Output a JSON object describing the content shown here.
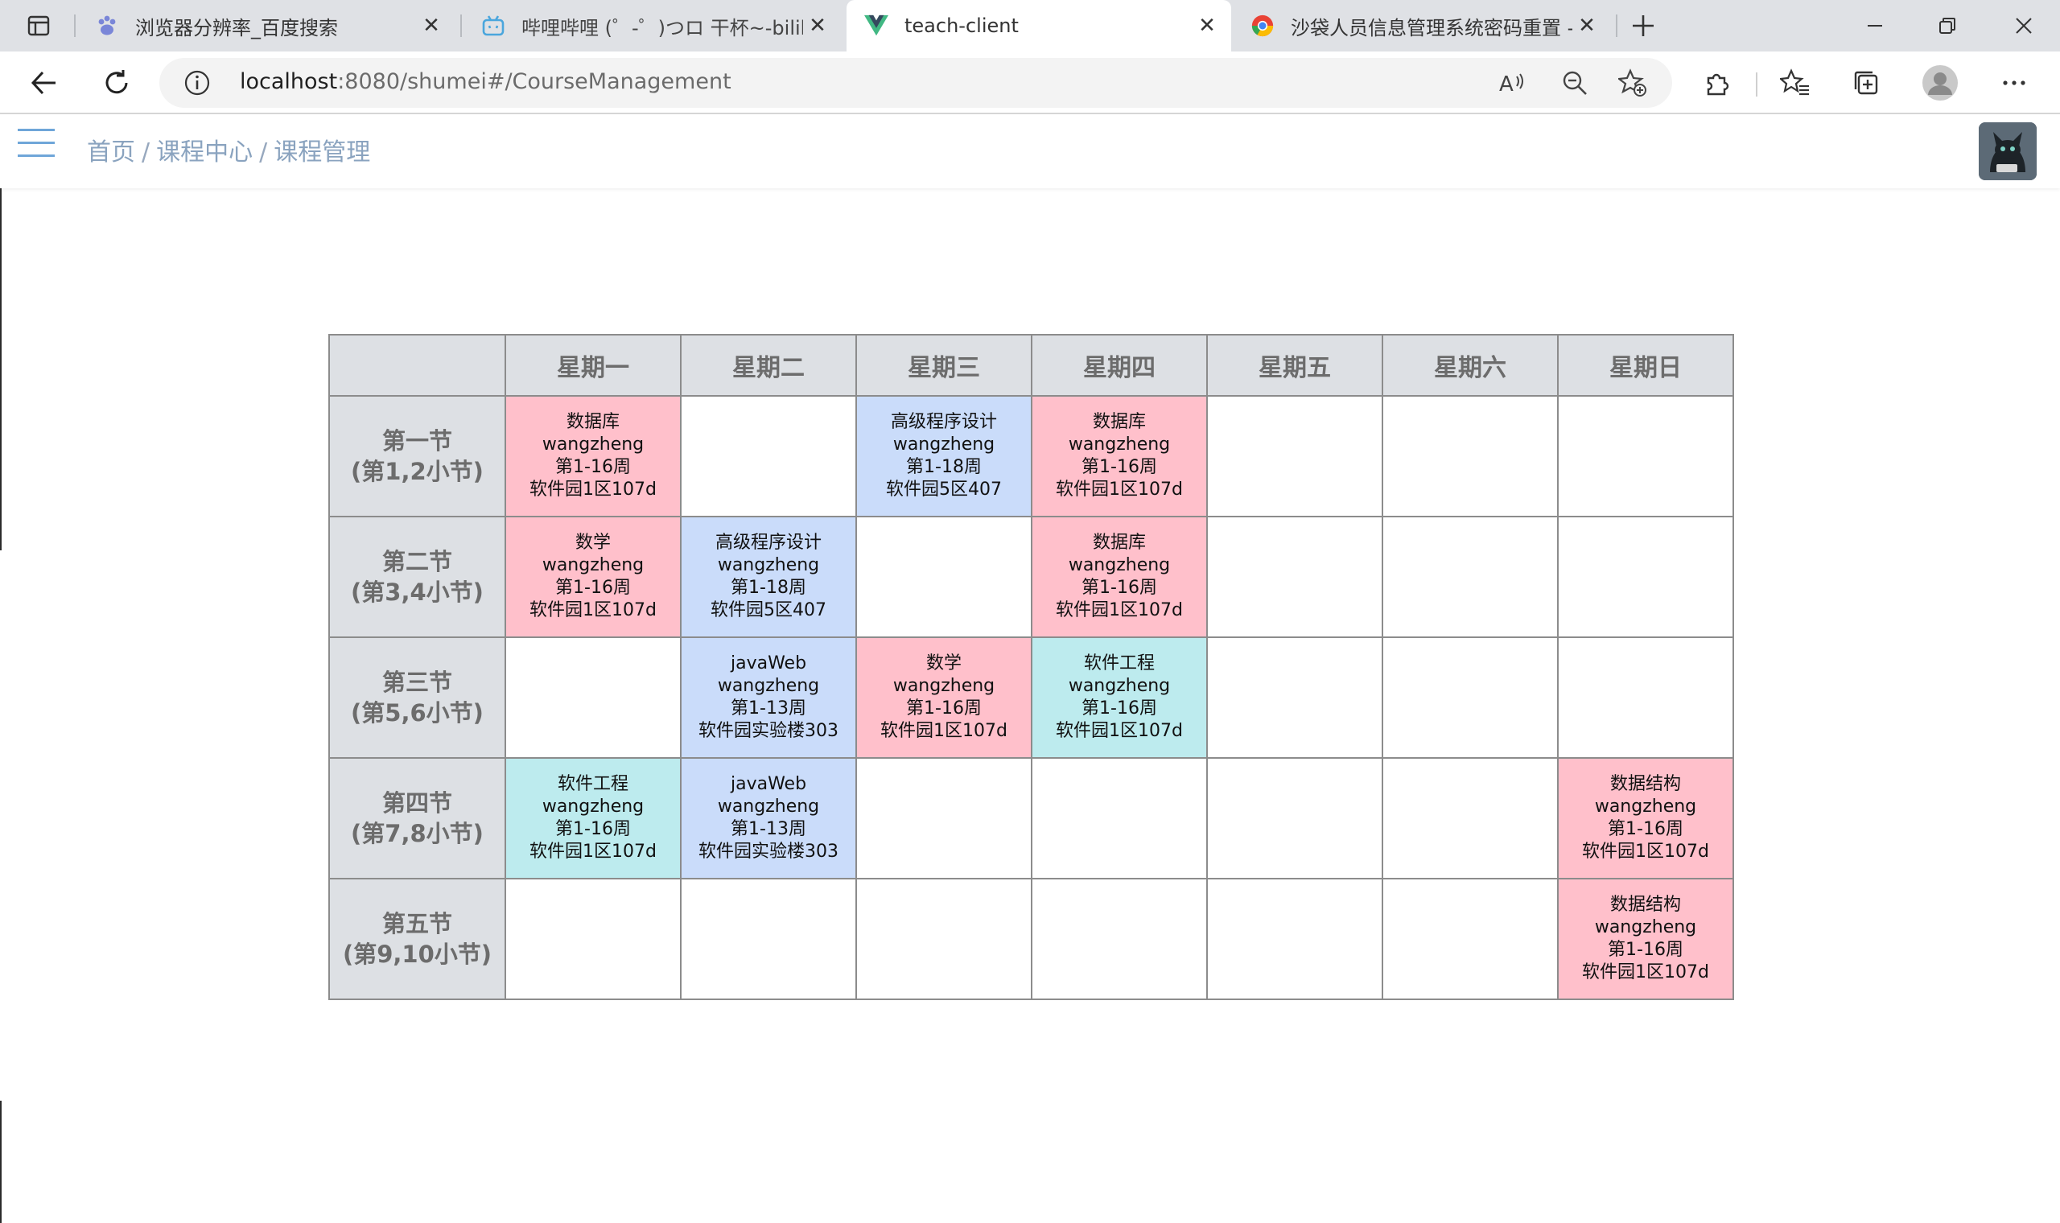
{
  "browser": {
    "tabs": [
      {
        "title": "浏览器分辨率_百度搜索",
        "icon": "baidu-paw-icon",
        "active": false
      },
      {
        "title": "哔哩哔哩 (゜-゜)つロ 干杯~-bilibili",
        "icon": "bilibili-tv-icon",
        "active": false
      },
      {
        "title": "teach-client",
        "icon": "vue-logo-icon",
        "active": true
      },
      {
        "title": "沙袋人员信息管理系统密码重置 - ...",
        "icon": "chrome-icon",
        "active": false
      }
    ],
    "url_host": "localhost",
    "url_rest": ":8080/shumei#/CourseManagement"
  },
  "header": {
    "breadcrumb": [
      "首页",
      "课程中心",
      "课程管理"
    ],
    "separator": "/"
  },
  "schedule": {
    "corner": "",
    "days": [
      "星期一",
      "星期二",
      "星期三",
      "星期四",
      "星期五",
      "星期六",
      "星期日"
    ],
    "periods": [
      {
        "name": "第一节",
        "detail": "(第1,2小节)"
      },
      {
        "name": "第二节",
        "detail": "(第3,4小节)"
      },
      {
        "name": "第三节",
        "detail": "(第5,6小节)"
      },
      {
        "name": "第四节",
        "detail": "(第7,8小节)"
      },
      {
        "name": "第五节",
        "detail": "(第9,10小节)"
      }
    ],
    "cells": [
      [
        {
          "color": "pink",
          "course": "数据库",
          "teacher": "wangzheng",
          "weeks": "第1-16周",
          "room": "软件园1区107d"
        },
        null,
        {
          "color": "blue",
          "course": "高级程序设计",
          "teacher": "wangzheng",
          "weeks": "第1-18周",
          "room": "软件园5区407"
        },
        {
          "color": "pink",
          "course": "数据库",
          "teacher": "wangzheng",
          "weeks": "第1-16周",
          "room": "软件园1区107d"
        },
        null,
        null,
        null
      ],
      [
        {
          "color": "pink",
          "course": "数学",
          "teacher": "wangzheng",
          "weeks": "第1-16周",
          "room": "软件园1区107d"
        },
        {
          "color": "blue",
          "course": "高级程序设计",
          "teacher": "wangzheng",
          "weeks": "第1-18周",
          "room": "软件园5区407"
        },
        null,
        {
          "color": "pink",
          "course": "数据库",
          "teacher": "wangzheng",
          "weeks": "第1-16周",
          "room": "软件园1区107d"
        },
        null,
        null,
        null
      ],
      [
        null,
        {
          "color": "blue",
          "course": "javaWeb",
          "teacher": "wangzheng",
          "weeks": "第1-13周",
          "room": "软件园实验楼303"
        },
        {
          "color": "pink",
          "course": "数学",
          "teacher": "wangzheng",
          "weeks": "第1-16周",
          "room": "软件园1区107d"
        },
        {
          "color": "cyan",
          "course": "软件工程",
          "teacher": "wangzheng",
          "weeks": "第1-16周",
          "room": "软件园1区107d"
        },
        null,
        null,
        null
      ],
      [
        {
          "color": "cyan",
          "course": "软件工程",
          "teacher": "wangzheng",
          "weeks": "第1-16周",
          "room": "软件园1区107d"
        },
        {
          "color": "blue",
          "course": "javaWeb",
          "teacher": "wangzheng",
          "weeks": "第1-13周",
          "room": "软件园实验楼303"
        },
        null,
        null,
        null,
        null,
        {
          "color": "pink",
          "course": "数据结构",
          "teacher": "wangzheng",
          "weeks": "第1-16周",
          "room": "软件园1区107d"
        }
      ],
      [
        null,
        null,
        null,
        null,
        null,
        null,
        {
          "color": "pink",
          "course": "数据结构",
          "teacher": "wangzheng",
          "weeks": "第1-16周",
          "room": "软件园1区107d"
        }
      ]
    ]
  },
  "colors": {
    "pink": "#ffc0cb",
    "blue": "#cadcfa",
    "cyan": "#bdebee",
    "header_gray": "#dde0e4",
    "breadcrumb": "#8aa3bf"
  }
}
